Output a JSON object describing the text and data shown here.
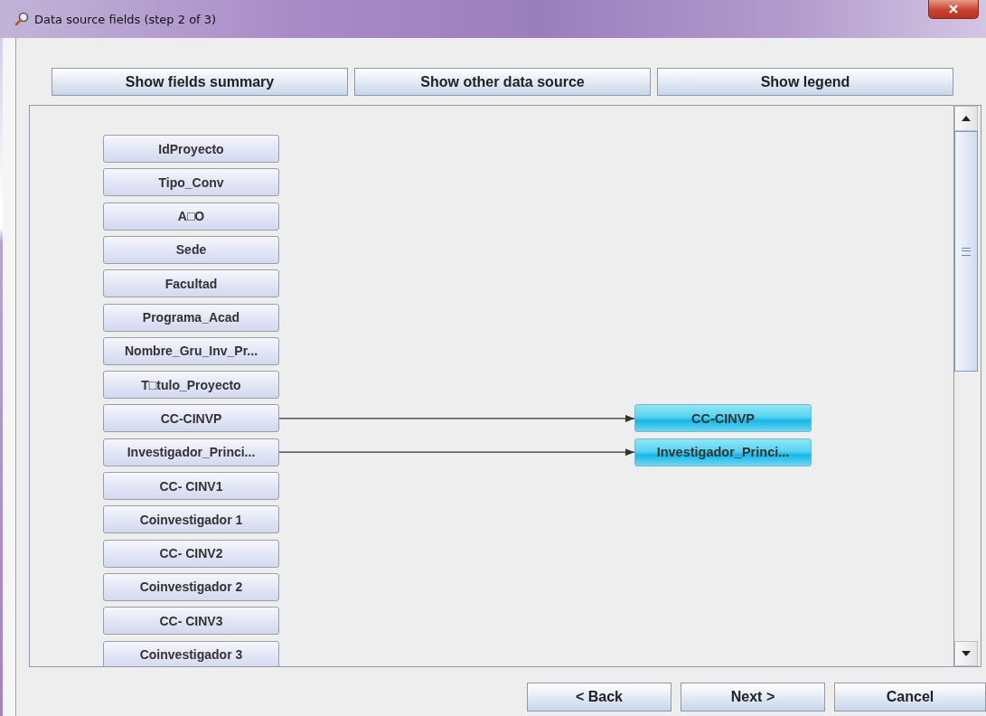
{
  "window": {
    "title": "Data source fields (step 2 of 3)"
  },
  "toolbar": [
    "Show fields summary",
    "Show other data source",
    "Show legend"
  ],
  "source_fields": [
    {
      "label": "IdProyecto"
    },
    {
      "label": "Tipo_Conv"
    },
    {
      "label": "A□O"
    },
    {
      "label": "Sede"
    },
    {
      "label": "Facultad"
    },
    {
      "label": "Programa_Acad"
    },
    {
      "label": "Nombre_Gru_Inv_Pr..."
    },
    {
      "label": "T□tulo_Proyecto"
    },
    {
      "label": "CC-CINVP",
      "mapped": true
    },
    {
      "label": "Investigador_Princi...",
      "mapped": true
    },
    {
      "label": "CC- CINV1"
    },
    {
      "label": "Coinvestigador 1"
    },
    {
      "label": "CC- CINV2"
    },
    {
      "label": "Coinvestigador 2"
    },
    {
      "label": "CC- CINV3"
    },
    {
      "label": "Coinvestigador 3"
    }
  ],
  "target_fields": [
    {
      "label": "CC-CINVP"
    },
    {
      "label": "Investigador_Princi..."
    }
  ],
  "buttons": [
    "< Back",
    "Next >",
    "Cancel"
  ]
}
